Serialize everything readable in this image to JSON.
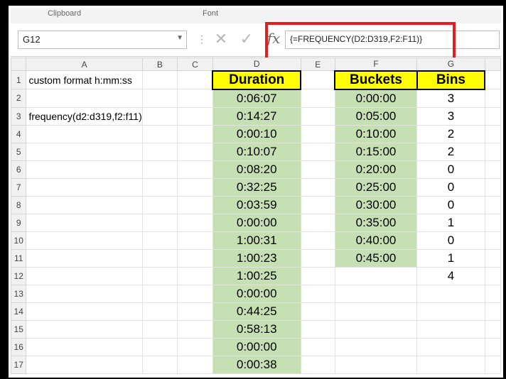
{
  "ribbon": {
    "group1": "Clipboard",
    "group2": "Font"
  },
  "formula_bar": {
    "name_box": "G12",
    "cancel_symbol": "✕",
    "enter_symbol": "✓",
    "fx_symbol": "fx",
    "formula": "{=FREQUENCY(D2:D319,F2:F11)}"
  },
  "columns": [
    "A",
    "B",
    "C",
    "D",
    "E",
    "F",
    "G"
  ],
  "rows": [
    "1",
    "2",
    "3",
    "4",
    "5",
    "6",
    "7",
    "8",
    "9",
    "10",
    "11",
    "12",
    "13",
    "14",
    "15",
    "16",
    "17"
  ],
  "cells": {
    "a1": "custom format h:mm:ss",
    "a3": "frequency(d2:d319,f2:f11)",
    "d1": "Duration",
    "f1": "Buckets",
    "g1": "Bins"
  },
  "duration": [
    "0:06:07",
    "0:14:27",
    "0:00:10",
    "0:10:07",
    "0:08:20",
    "0:32:25",
    "0:03:59",
    "0:00:00",
    "1:00:31",
    "1:00:23",
    "1:00:25",
    "0:00:00",
    "0:44:25",
    "0:58:13",
    "0:00:00",
    "0:00:38"
  ],
  "buckets": [
    "0:00:00",
    "0:05:00",
    "0:10:00",
    "0:15:00",
    "0:20:00",
    "0:25:00",
    "0:30:00",
    "0:35:00",
    "0:40:00",
    "0:45:00"
  ],
  "bins": [
    "3",
    "3",
    "2",
    "2",
    "0",
    "0",
    "0",
    "1",
    "0",
    "1",
    "4"
  ],
  "colors": {
    "highlight": "#e02020",
    "header_fill": "#ffff00",
    "data_fill": "#c6e0b4"
  }
}
